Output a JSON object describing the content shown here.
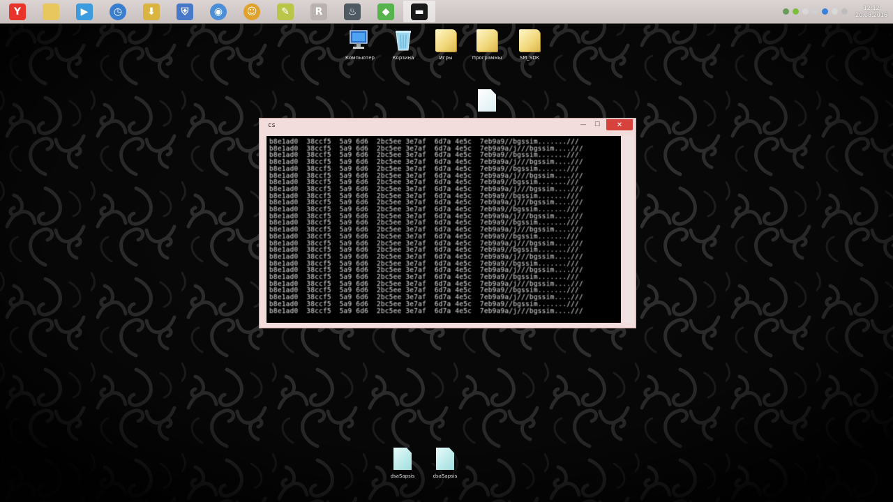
{
  "taskbar": {
    "apps": [
      {
        "name": "yandex-browser-icon",
        "glyph": "Y",
        "color": "#e8342a",
        "active": false
      },
      {
        "name": "file-explorer-icon",
        "glyph": "",
        "color": "#e7c75e",
        "active": false
      },
      {
        "name": "media-player-icon",
        "glyph": "▶",
        "color": "#3d9be0",
        "active": false
      },
      {
        "name": "clock-app-icon",
        "glyph": "◷",
        "color": "#3a7ed0",
        "active": false,
        "round": true
      },
      {
        "name": "download-app-icon",
        "glyph": "⬇",
        "color": "#d9b441",
        "active": false
      },
      {
        "name": "security-shield-icon",
        "glyph": "⛨",
        "color": "#4a78c8",
        "active": false
      },
      {
        "name": "globe-icon",
        "glyph": "◉",
        "color": "#4c8fd8",
        "active": false,
        "round": true
      },
      {
        "name": "smiley-app-icon",
        "glyph": "☺",
        "color": "#e0a22c",
        "active": false,
        "round": true
      },
      {
        "name": "paint-app-icon",
        "glyph": "✎",
        "color": "#b9c64a",
        "active": false
      },
      {
        "name": "rpg-app-icon",
        "glyph": "R",
        "color": "#b9b2b0",
        "active": false
      },
      {
        "name": "steam-icon",
        "glyph": "♨",
        "color": "#4f5a62",
        "active": false
      },
      {
        "name": "colorful-app-icon",
        "glyph": "◆",
        "color": "#57b34e",
        "active": false
      },
      {
        "name": "command-prompt-icon",
        "glyph": "▬",
        "color": "#1a1a1a",
        "active": true
      }
    ],
    "tray": {
      "icons": [
        {
          "name": "tray-arrow-icon",
          "color": "#6a9a5a"
        },
        {
          "name": "tray-nvidia-icon",
          "color": "#7cbf3a"
        },
        {
          "name": "tray-network-icon",
          "color": "#d8d8d8"
        },
        {
          "name": "tray-status-icon",
          "color": "#cfcfcf"
        },
        {
          "name": "tray-bluetooth-icon",
          "color": "#3a80d8"
        },
        {
          "name": "tray-volume-icon",
          "color": "#d8d8d8"
        },
        {
          "name": "tray-language-icon",
          "color": "#bdbdbd"
        }
      ],
      "clock_time": "12:12",
      "clock_date": "20.08.2016"
    }
  },
  "desktop_icons": [
    {
      "name": "desktop-icon-computer",
      "label": "Компьютер",
      "type": "computer"
    },
    {
      "name": "desktop-icon-recycle-bin",
      "label": "Корзина",
      "type": "bin"
    },
    {
      "name": "desktop-icon-games",
      "label": "Игры",
      "type": "folder"
    },
    {
      "name": "desktop-icon-programs",
      "label": "Программы",
      "type": "folder"
    },
    {
      "name": "desktop-icon-folder-3",
      "label": "SM_SDK",
      "type": "folder"
    },
    {
      "name": "desktop-icon-document",
      "label": "",
      "type": "doc"
    },
    {
      "name": "desktop-icon-file-1",
      "label": "dsaSapsis",
      "type": "doc-teal"
    },
    {
      "name": "desktop-icon-file-2",
      "label": "dsaSapsis",
      "type": "doc-teal"
    }
  ],
  "console_window": {
    "title": "cs",
    "close_glyph": "✕",
    "minimize_glyph": "—",
    "maximize_glyph": "☐",
    "lines": [
      "b8e1ad0  38ccf5  5a9 6d6  2bc5ee 3e7af  6d7a 4e5c  7eb9a9//bgssim.......///",
      "b8e1ad0  38ccf5  5a9 6d6  2bc5ee 3e7af  6d7a 4e5c  7eb9a9a/j///bgssim....///",
      "b8e1ad0  38ccf5  5a9 6d6  2bc5ee 3e7af  6d7a 4e5c  7eb9a9//bgssim.......///",
      "b8e1ad0  38ccf5  5a9 6d6  2bc5ee 3e7af  6d7a 4e5c  7eb9a9a/j///bgssim....///",
      "b8e1ad0  38ccf5  5a9 6d6  2bc5ee 3e7af  6d7a 4e5c  7eb9a9//bgssim.......///",
      "b8e1ad0  38ccf5  5a9 6d6  2bc5ee 3e7af  6d7a 4e5c  7eb9a9a/j///bgssim....///",
      "b8e1ad0  38ccf5  5a9 6d6  2bc5ee 3e7af  6d7a 4e5c  7eb9a9//bgssim.......///",
      "b8e1ad0  38ccf5  5a9 6d6  2bc5ee 3e7af  6d7a 4e5c  7eb9a9a/j///bgssim....///",
      "b8e1ad0  38ccf5  5a9 6d6  2bc5ee 3e7af  6d7a 4e5c  7eb9a9//bgssim.......///",
      "b8e1ad0  38ccf5  5a9 6d6  2bc5ee 3e7af  6d7a 4e5c  7eb9a9a/j///bgssim....///",
      "b8e1ad0  38ccf5  5a9 6d6  2bc5ee 3e7af  6d7a 4e5c  7eb9a9//bgssim.......///",
      "b8e1ad0  38ccf5  5a9 6d6  2bc5ee 3e7af  6d7a 4e5c  7eb9a9a/j///bgssim....///",
      "b8e1ad0  38ccf5  5a9 6d6  2bc5ee 3e7af  6d7a 4e5c  7eb9a9//bgssim.......///",
      "b8e1ad0  38ccf5  5a9 6d6  2bc5ee 3e7af  6d7a 4e5c  7eb9a9a/j///bgssim....///",
      "b8e1ad0  38ccf5  5a9 6d6  2bc5ee 3e7af  6d7a 4e5c  7eb9a9//bgssim.......///",
      "b8e1ad0  38ccf5  5a9 6d6  2bc5ee 3e7af  6d7a 4e5c  7eb9a9a/j///bgssim....///",
      "b8e1ad0  38ccf5  5a9 6d6  2bc5ee 3e7af  6d7a 4e5c  7eb9a9//bgssim.......///",
      "b8e1ad0  38ccf5  5a9 6d6  2bc5ee 3e7af  6d7a 4e5c  7eb9a9a/j///bgssim....///",
      "b8e1ad0  38ccf5  5a9 6d6  2bc5ee 3e7af  6d7a 4e5c  7eb9a9//bgssim.......///",
      "b8e1ad0  38ccf5  5a9 6d6  2bc5ee 3e7af  6d7a 4e5c  7eb9a9a/j///bgssim....///",
      "b8e1ad0  38ccf5  5a9 6d6  2bc5ee 3e7af  6d7a 4e5c  7eb9a9//bgssim.......///",
      "b8e1ad0  38ccf5  5a9 6d6  2bc5ee 3e7af  6d7a 4e5c  7eb9a9a/j///bgssim....///",
      "b8e1ad0  38ccf5  5a9 6d6  2bc5ee 3e7af  6d7a 4e5c  7eb9a9//bgssim.......///",
      "b8e1ad0  38ccf5  5a9 6d6  2bc5ee 3e7af  6d7a 4e5c  7eb9a9a/j///bgssim....///",
      "b8e1ad0  38ccf5  5a9 6d6  2bc5ee 3e7af  6d7a 4e5c  7eb9a9//bgssim.......///",
      "b8e1ad0  38ccf5  5a9 6d6  2bc5ee 3e7af  6d7a 4e5c  7eb9a9a/j///bgssim....///"
    ]
  },
  "colors": {
    "taskbar_bg": "#d4cccb",
    "window_frame": "#f2dcdc",
    "close_button": "#d7433c",
    "console_bg": "#000000",
    "console_text": "#e9e6e6"
  }
}
